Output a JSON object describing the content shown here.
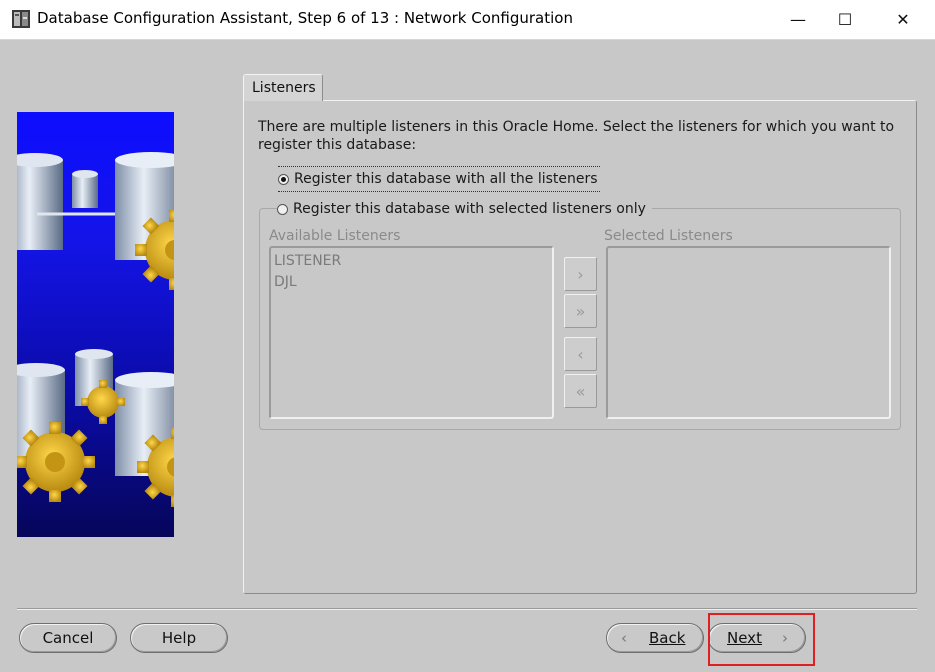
{
  "window": {
    "title": "Database Configuration Assistant, Step 6 of 13 : Network Configuration",
    "minimize_glyph": "—",
    "maximize_glyph": "☐",
    "close_glyph": "✕"
  },
  "tab": {
    "label": "Listeners"
  },
  "panel": {
    "intro": "There are multiple listeners in this Oracle Home. Select the listeners for which you want to register this database:",
    "option_all": {
      "label": "Register this database with all the listeners",
      "selected": true
    },
    "option_selected": {
      "label": "Register this database with selected listeners only",
      "selected": false
    },
    "available": {
      "label": "Available Listeners",
      "items": [
        "LISTENER",
        "DJL"
      ]
    },
    "selected": {
      "label": "Selected Listeners",
      "items": []
    },
    "move_buttons": {
      "add_one": "›",
      "add_all": "»",
      "remove_one": "‹",
      "remove_all": "«"
    }
  },
  "footer": {
    "cancel": "Cancel",
    "help": "Help",
    "back_chevron": "‹",
    "back_label": "Back",
    "next_label": "Next",
    "next_chevron": "›"
  },
  "colors": {
    "background": "#c8c8c8",
    "banner_blue": "#1414e8",
    "gear_gold": "#e3b21e",
    "highlight_red": "#e02020"
  }
}
